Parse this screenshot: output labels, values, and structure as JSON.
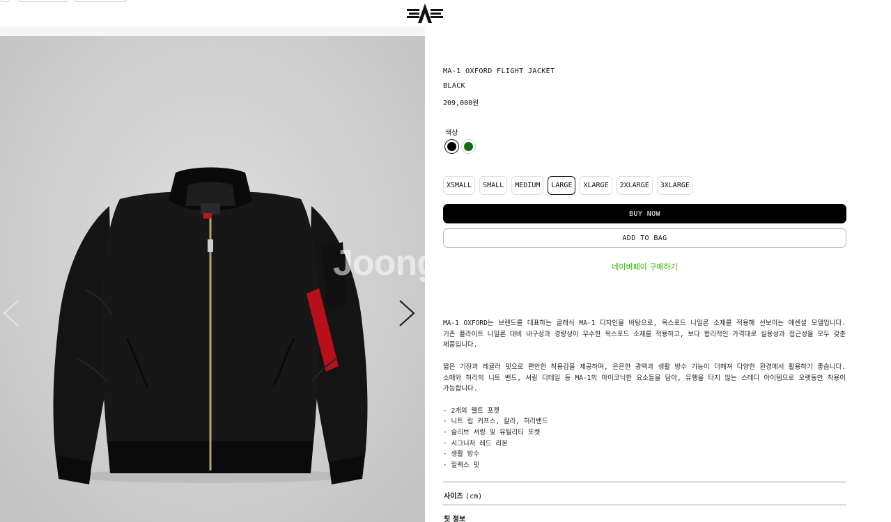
{
  "product": {
    "title": "MA-1 OXFORD FLIGHT JACKET",
    "color_name": "BLACK",
    "price": "209,000원",
    "watermark": "Joong"
  },
  "colors": {
    "label": "색상",
    "options": [
      {
        "name": "black",
        "hex": "#000000",
        "selected": true
      },
      {
        "name": "green",
        "hex": "#0f6a14",
        "selected": false
      }
    ]
  },
  "sizes": {
    "options": [
      "XSMALL",
      "SMALL",
      "MEDIUM",
      "LARGE",
      "XLARGE",
      "2XLARGE",
      "3XLARGE"
    ],
    "selected": "LARGE"
  },
  "actions": {
    "buy_now": "BUY NOW",
    "add_to_bag": "ADD TO BAG",
    "naver_pay": "네이버페이 구매하기"
  },
  "description": {
    "p1": "MA-1 OXFORD는 브랜드를 대표하는 클래식 MA-1 디자인을 바탕으로, 옥스포드 나일론 소재를 적용해 선보이는 에센셜 모델입니다. 기존 플라이트 나일론 대비 내구성과 경량성이 우수한 옥스포드 소재를 적용하고, 보다 합리적인 가격대로 실용성과 접근성을 모두 갖춘 제품입니다.",
    "p2": "짧은 기장과 레귤러 핏으로 편안한 착용감을 제공하며, 은은한 광택과 생활 방수 기능이 더해져 다양한 환경에서 활용하기 좋습니다. 소매와 허리의 니트 밴드, 셔링 디테일 등 MA-1의 아이코닉한 요소들을 담아, 유행을 타지 않는 스테디 아이템으로 오랫동안 착용이 가능합니다.",
    "features": [
      "2개의 웰트 포켓",
      "니트 립 커프스, 칼라, 허리밴드",
      "슬리브 셔링 및 유틸리티 포켓",
      "시그니처 레드 리본",
      "생활 방수",
      "릴렉스 핏"
    ]
  },
  "accordion": {
    "size_label": "사이즈",
    "size_unit": "(cm)",
    "fit_label": "핏 정보"
  },
  "icons": {
    "logo": "alpha-industries-logo-icon",
    "prev": "chevron-left-icon",
    "next": "chevron-right-icon"
  }
}
